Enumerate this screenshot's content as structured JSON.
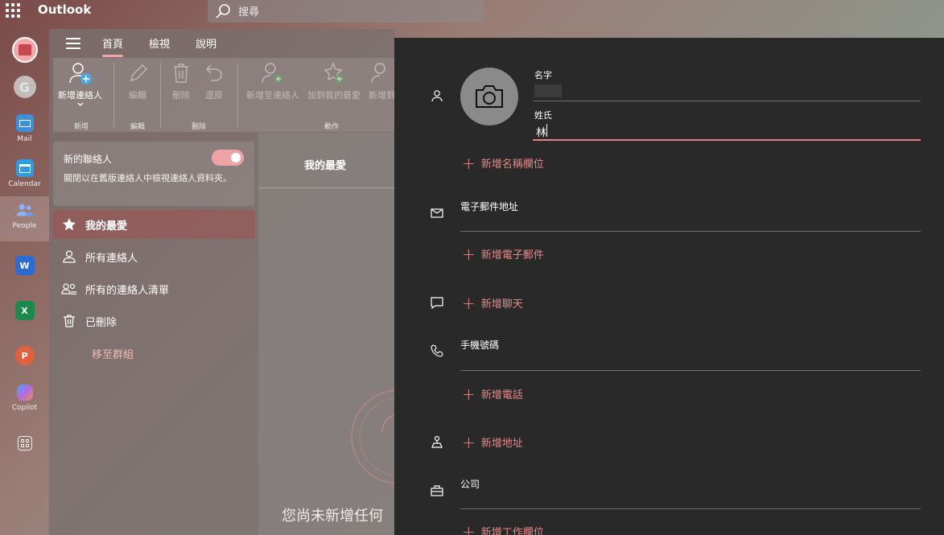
{
  "app": {
    "title": "Outlook",
    "search_placeholder": "搜尋"
  },
  "rail": [
    {
      "name": "outlook",
      "label": ""
    },
    {
      "name": "google",
      "label": ""
    },
    {
      "name": "mail",
      "label": "Mail"
    },
    {
      "name": "calendar",
      "label": "Calendar"
    },
    {
      "name": "people",
      "label": "People"
    },
    {
      "name": "word",
      "label": ""
    },
    {
      "name": "excel",
      "label": ""
    },
    {
      "name": "powerpoint",
      "label": ""
    },
    {
      "name": "copilot",
      "label": "Copilot"
    },
    {
      "name": "more-apps",
      "label": ""
    }
  ],
  "tabs": [
    "首頁",
    "檢視",
    "說明"
  ],
  "ribbon": {
    "new_contact": "新增連絡人",
    "edit": "編輯",
    "delete": "刪除",
    "restore": "還原",
    "add_to_contacts": "新增至連絡人",
    "add_to_favorites": "加到我的最愛",
    "new_more": "新增到",
    "groups": {
      "new": "新增",
      "edit": "編輯",
      "delete": "刪除",
      "actions": "動作"
    }
  },
  "new_contacts_card": {
    "title": "新的聯絡人",
    "description": "關閉以在舊版連絡人中檢視連絡人資料夾。",
    "toggle_on": true
  },
  "nav": {
    "favorites": "我的最愛",
    "all_contacts": "所有連絡人",
    "all_lists": "所有的連絡人清單",
    "deleted": "已刪除",
    "move_to_groups": "移至群組"
  },
  "list": {
    "header": "我的最愛",
    "empty_text": "您尚未新增任何"
  },
  "editor": {
    "first_name_label": "名字",
    "first_name_value": "",
    "last_name_label": "姓氏",
    "last_name_value": "林",
    "add_name_field": "新增名稱欄位",
    "email_label": "電子郵件地址",
    "add_email": "新增電子郵件",
    "add_chat": "新增聊天",
    "phone_label": "手機號碼",
    "add_phone": "新增電話",
    "add_address": "新增地址",
    "company_label": "公司",
    "add_work_field": "新增工作欄位"
  },
  "colors": {
    "accent": "#e9878a",
    "panel_bg": "#292929"
  }
}
